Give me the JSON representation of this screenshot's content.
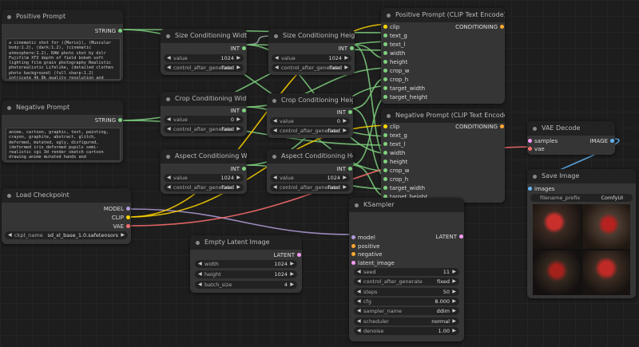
{
  "nodes": {
    "positive_prompt": {
      "title": "Positive Prompt",
      "output": "STRING",
      "text": "a cinematic shot for ({Mario}), (Muscular body:1.2), (dark:1.2), (cinematic atmosphere:1.2), RAW photo shot by dslr Fujifilm XT3 depth of field bokeh soft lighting film grain photography Realistic photorealistic Lifelike, (detailed clothes photo background) (full sharp:1.2) intricate 4k 8k quality resolution and extremely ultra skin texture"
    },
    "negative_prompt": {
      "title": "Negative Prompt",
      "output": "STRING",
      "text": "anime, cartoon, graphic, text, painting, crayon, graphite, abstract, glitch, deformed, mutated, ugly, disfigured, (deformed iris deformed pupils semi-realistic cgi 3d render sketch cartoon drawing anime mutated hands and fingers:1.4) (deformed distorted"
    },
    "size_w": {
      "title": "Size Conditioning Width",
      "output": "INT",
      "widget_label": "value",
      "widget_value": "1024",
      "ctrl_label": "control_after_generate",
      "ctrl_value": "fixed"
    },
    "size_h": {
      "title": "Size Conditioning Height",
      "output": "INT",
      "widget_label": "value",
      "widget_value": "1024",
      "ctrl_label": "control_after_generate",
      "ctrl_value": "fixed"
    },
    "crop_w": {
      "title": "Crop Conditioning Width",
      "output": "INT",
      "widget_label": "value",
      "widget_value": "0",
      "ctrl_label": "control_after_generate",
      "ctrl_value": "fixed"
    },
    "crop_h": {
      "title": "Crop Conditioning Height",
      "output": "INT",
      "widget_label": "value",
      "widget_value": "0",
      "ctrl_label": "control_after_generate",
      "ctrl_value": "fixed"
    },
    "aspect_w": {
      "title": "Aspect Conditioning Width",
      "output": "INT",
      "widget_label": "value",
      "widget_value": "1024",
      "ctrl_label": "control_after_generate",
      "ctrl_value": "fixed"
    },
    "aspect_h": {
      "title": "Aspect Conditioning Height",
      "output": "INT",
      "widget_label": "value",
      "widget_value": "1024",
      "ctrl_label": "control_after_generate",
      "ctrl_value": "fixed"
    },
    "pos_clip": {
      "title": "Positive Prompt (CLIP Text Encode)",
      "output": "CONDITIONING",
      "inputs": [
        "clip",
        "text_g",
        "text_l",
        "width",
        "height",
        "crop_w",
        "crop_h",
        "target_width",
        "target_height"
      ]
    },
    "neg_clip": {
      "title": "Negative Prompt (CLIP Text Encode)",
      "output": "CONDITIONING",
      "inputs": [
        "clip",
        "text_g",
        "text_l",
        "width",
        "height",
        "crop_w",
        "crop_h",
        "target_width",
        "target_height"
      ]
    },
    "checkpoint": {
      "title": "Load Checkpoint",
      "outputs": [
        "MODEL",
        "CLIP",
        "VAE"
      ],
      "widget_label": "ckpt_name",
      "widget_value": "sd_xl_base_1.0.safetensors"
    },
    "latent": {
      "title": "Empty Latent Image",
      "output": "LATENT",
      "widgets": [
        {
          "label": "width",
          "value": "1024"
        },
        {
          "label": "height",
          "value": "1024"
        },
        {
          "label": "batch_size",
          "value": "4"
        }
      ]
    },
    "ksampler": {
      "title": "KSampler",
      "output": "LATENT",
      "inputs": [
        "model",
        "positive",
        "negative",
        "latent_image"
      ],
      "widgets": [
        {
          "label": "seed",
          "value": "11"
        },
        {
          "label": "control_after_generate",
          "value": "fixed"
        },
        {
          "label": "steps",
          "value": "50"
        },
        {
          "label": "cfg",
          "value": "8.000"
        },
        {
          "label": "sampler_name",
          "value": "ddim"
        },
        {
          "label": "scheduler",
          "value": "normal"
        },
        {
          "label": "denoise",
          "value": "1.00"
        }
      ]
    },
    "vae_decode": {
      "title": "VAE Decode",
      "inputs": [
        "samples",
        "vae"
      ],
      "output": "IMAGE"
    },
    "save_image": {
      "title": "Save Image",
      "input": "images",
      "widget_label": "filename_prefix",
      "widget_value": "ComfyUI"
    }
  },
  "colors": {
    "clip": "#ffd500",
    "model": "#b39ddb",
    "vae": "#ff6e6e",
    "conditioning": "#ffa931",
    "latent": "#ff9cf9",
    "int": "#7fd17f",
    "image": "#64b5f6",
    "wire_int": "#9aa"
  }
}
